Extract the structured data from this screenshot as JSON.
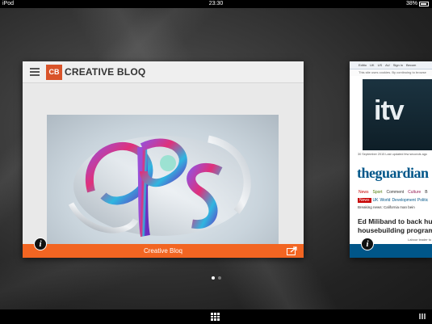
{
  "status_bar": {
    "device": "iPod",
    "time": "23:30",
    "battery": "38%"
  },
  "tabs": [
    {
      "site_name": "CREATIVE BLOQ",
      "logo_text": "CB",
      "title": "Creative Bloq",
      "accent_color": "#f26522"
    },
    {
      "site_name": "theguardian",
      "nav_items": [
        "Editio",
        "UK",
        "US",
        "AU",
        "Sign in",
        "Becom"
      ],
      "cookie_notice": "This site uses cookies. By continuing to browse",
      "hero_text": "itv",
      "date_line": "30 September 2015 Last updated few seconds ago",
      "sections": [
        "News",
        "Sport",
        "Comment",
        "Culture",
        "B"
      ],
      "subsections": [
        "News",
        "UK",
        "World",
        "Development",
        "Politic"
      ],
      "breaking": "Breaking news: California man bein",
      "headline_lines": [
        "Ed Miliband to back hug",
        "housebuilding program"
      ],
      "byline": "Labour leader to",
      "brand_color": "#005689"
    }
  ],
  "page_indicator": {
    "count": 2,
    "active": 0
  }
}
